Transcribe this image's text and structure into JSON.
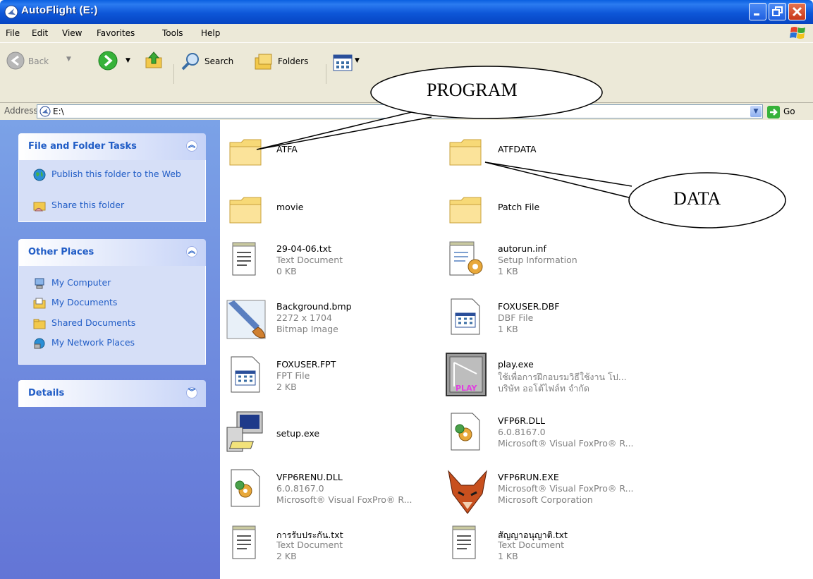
{
  "window": {
    "title": "AutoFlight (E:)"
  },
  "menu": [
    "File",
    "Edit",
    "View",
    "Favorites",
    "Tools",
    "Help"
  ],
  "toolbar": {
    "back": "Back",
    "search": "Search",
    "folders": "Folders"
  },
  "address": {
    "label": "Address",
    "value": "E:\\",
    "go": "Go"
  },
  "tasks": {
    "file_folder": {
      "title": "File and Folder Tasks",
      "items": [
        "Publish this folder to the Web",
        "Share this folder"
      ]
    },
    "other_places": {
      "title": "Other Places",
      "items": [
        "My Computer",
        "My Documents",
        "Shared Documents",
        "My Network Places"
      ]
    },
    "details": {
      "title": "Details"
    }
  },
  "files": [
    {
      "name": "ATFA",
      "lines": []
    },
    {
      "name": "ATFDATA",
      "lines": []
    },
    {
      "name": "movie",
      "lines": []
    },
    {
      "name": "Patch File",
      "lines": []
    },
    {
      "name": "29-04-06.txt",
      "lines": [
        "Text Document",
        "0 KB"
      ]
    },
    {
      "name": "autorun.inf",
      "lines": [
        "Setup Information",
        "1 KB"
      ]
    },
    {
      "name": "Background.bmp",
      "lines": [
        "2272 x 1704",
        "Bitmap Image"
      ]
    },
    {
      "name": "FOXUSER.DBF",
      "lines": [
        "DBF File",
        "1 KB"
      ]
    },
    {
      "name": "FOXUSER.FPT",
      "lines": [
        "FPT File",
        "2 KB"
      ]
    },
    {
      "name": "play.exe",
      "lines": [
        "ใช้เพื่อการฝึกอบรมวิธีใช้งาน โป...",
        "บริษัท ออโต้ไฟล์ท จำกัด"
      ]
    },
    {
      "name": "setup.exe",
      "lines": []
    },
    {
      "name": "VFP6R.DLL",
      "lines": [
        "6.0.8167.0",
        "Microsoft® Visual FoxPro® R..."
      ]
    },
    {
      "name": "VFP6RENU.DLL",
      "lines": [
        "6.0.8167.0",
        "Microsoft® Visual FoxPro® R..."
      ]
    },
    {
      "name": "VFP6RUN.EXE",
      "lines": [
        "Microsoft® Visual FoxPro® R...",
        "Microsoft Corporation"
      ]
    },
    {
      "name": "การรับประกัน.txt",
      "lines": [
        "Text Document",
        "2 KB"
      ]
    },
    {
      "name": "สัญญาอนุญาติ.txt",
      "lines": [
        "Text Document",
        "1 KB"
      ]
    }
  ],
  "callouts": {
    "program": "PROGRAM",
    "data": "DATA"
  }
}
